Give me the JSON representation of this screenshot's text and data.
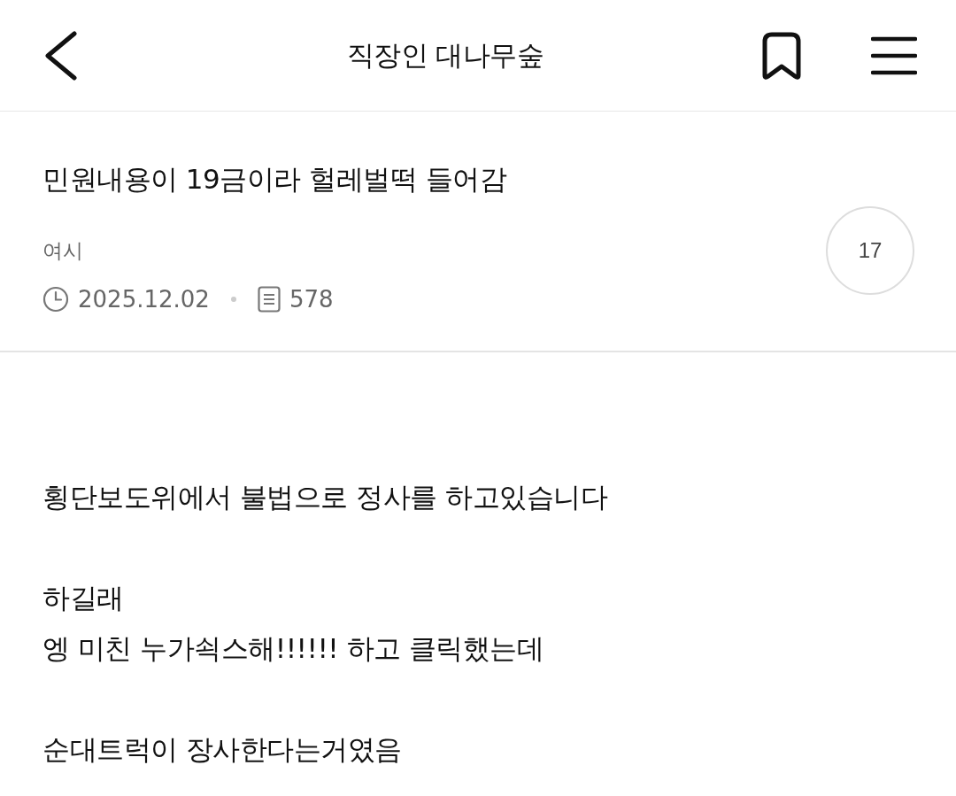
{
  "header": {
    "title": "직장인 대나무숲"
  },
  "post": {
    "title": "민원내용이 19금이라 헐레벌떡 들어감",
    "author": "여시",
    "date": "2025.12.02",
    "views": "578",
    "comment_count": "17"
  },
  "body": {
    "paragraphs": [
      [
        "횡단보도위에서 불법으로 정사를 하고있습니다"
      ],
      [
        "하길래",
        "엥 미친 누가쇡스해!!!!!! 하고 클릭했는데"
      ],
      [
        "순대트럭이 장사한다는거였음"
      ]
    ]
  }
}
